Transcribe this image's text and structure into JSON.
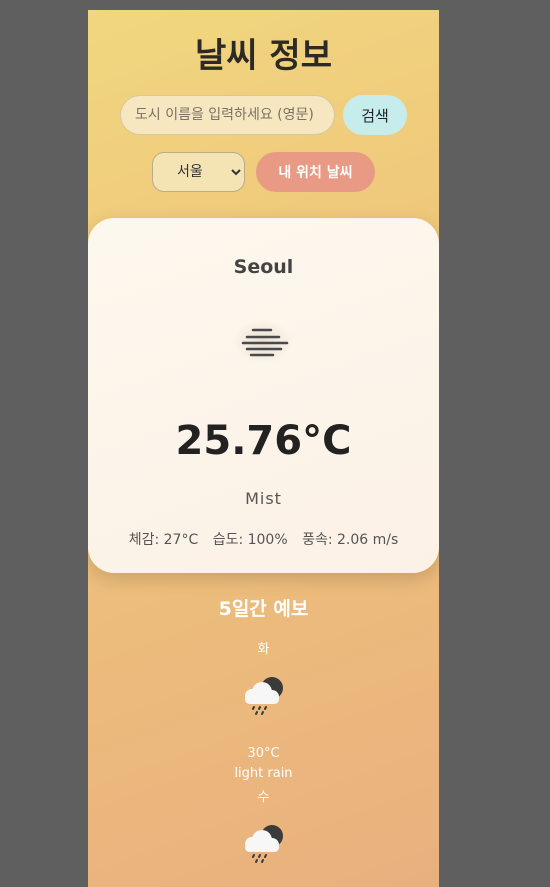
{
  "header": {
    "title": "날씨 정보"
  },
  "search": {
    "placeholder": "도시 이름을 입력하세요 (영문)",
    "button_label": "검색"
  },
  "location": {
    "selected_city": "서울",
    "my_location_label": "내 위치 날씨"
  },
  "current": {
    "city": "Seoul",
    "icon": "mist-icon",
    "temperature": "25.76°C",
    "description": "Mist",
    "feels_like": "체감: 27°C",
    "humidity": "습도: 100%",
    "wind": "풍속: 2.06 m/s"
  },
  "forecast": {
    "title": "5일간 예보",
    "days": [
      {
        "day": "화",
        "icon": "rain-cloud-icon",
        "temp": "30°C",
        "desc": "light rain"
      },
      {
        "day": "수",
        "icon": "rain-cloud-icon",
        "temp": "",
        "desc": ""
      }
    ]
  },
  "colors": {
    "background": "#5f5f5f",
    "search_button": "#c6ecec",
    "location_button": "#e99a85",
    "card": "#fdf8ee"
  }
}
